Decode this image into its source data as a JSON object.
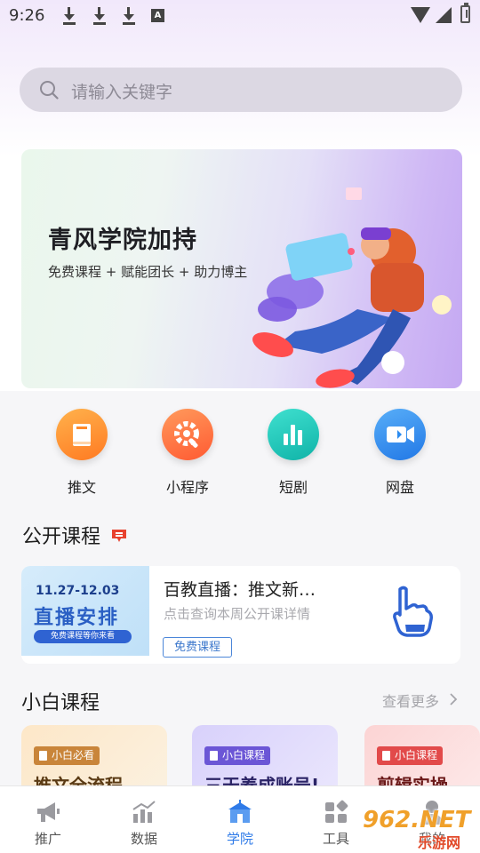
{
  "status_bar": {
    "time": "9:26",
    "icons": [
      "download-icon",
      "download-icon",
      "download-icon",
      "a-icon",
      "wifi-icon",
      "signal-icon",
      "battery-icon"
    ]
  },
  "search": {
    "placeholder": "请输入关键字",
    "icon": "search-icon"
  },
  "banner": {
    "title": "青风学院加持",
    "subtitle": "免费课程 + 赋能团长 + 助力博主"
  },
  "quick_links": [
    {
      "label": "推文",
      "icon": "book-icon",
      "color": "#ff8a2b"
    },
    {
      "label": "小程序",
      "icon": "gear-icon",
      "color": "#ff6a3d"
    },
    {
      "label": "短剧",
      "icon": "bar-chart-icon",
      "color": "#17c3b8"
    },
    {
      "label": "网盘",
      "icon": "video-icon",
      "color": "#2c8cf0"
    }
  ],
  "public_section": {
    "title": "公开课程",
    "card": {
      "thumb_date": "11.27-12.03",
      "thumb_title": "直播安排",
      "thumb_pill": "免费课程等你来看",
      "title": "百教直播：推文新…",
      "description": "点击查询本周公开课详情",
      "tag": "免费课程"
    }
  },
  "beginner_section": {
    "title": "小白课程",
    "more": "查看更多",
    "cards": [
      {
        "tag": "小白必看",
        "text": "推文全流程",
        "tag_color": "#c9853a",
        "text_color": "#5a3a14",
        "bg": "#fbe9cf"
      },
      {
        "tag": "小白课程",
        "text": "三天养成账号!",
        "tag_color": "#6b56d6",
        "text_color": "#2b2466",
        "bg": "#e2dcfb"
      },
      {
        "tag": "小白课程",
        "text": "剪辑实操",
        "tag_color": "#e24a4a",
        "text_color": "#6a1818",
        "bg": "#fde0e0"
      }
    ]
  },
  "tabbar": {
    "tabs": [
      {
        "label": "推广",
        "icon": "megaphone-icon"
      },
      {
        "label": "数据",
        "icon": "chart-icon"
      },
      {
        "label": "学院",
        "icon": "school-icon"
      },
      {
        "label": "工具",
        "icon": "tools-icon"
      },
      {
        "label": "我的",
        "icon": "user-icon"
      }
    ],
    "active": "学院"
  },
  "watermark": {
    "text": "962.NET",
    "sub": "乐游网"
  },
  "colors": {
    "accent": "#2f7be8",
    "search_bg": "#dcd8e3"
  }
}
